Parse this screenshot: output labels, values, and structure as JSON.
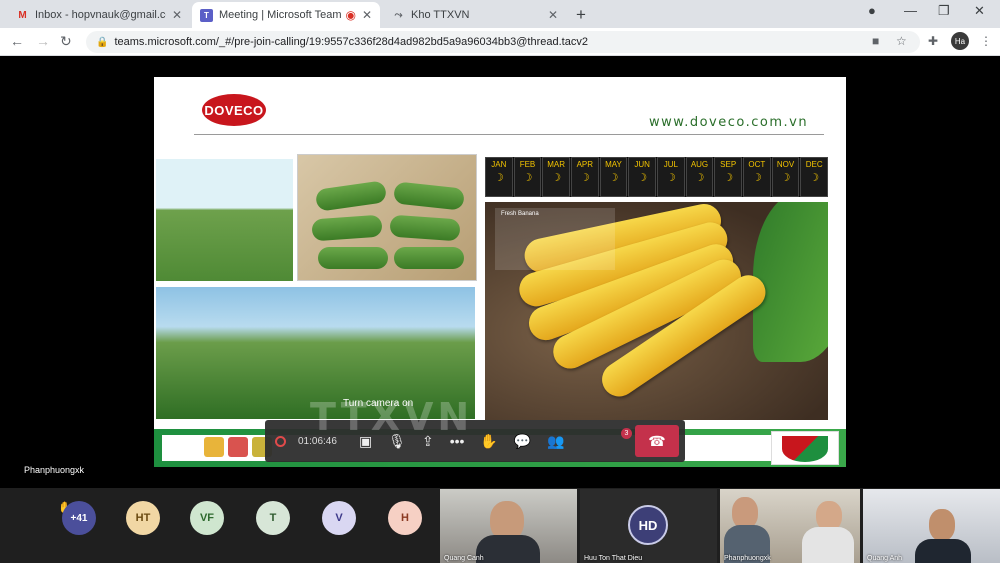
{
  "browser": {
    "tabs": [
      {
        "title": "Inbox - hopvnauk@gmail.com",
        "icon": "gmail-icon"
      },
      {
        "title": "Meeting | Microsoft Teams",
        "icon": "teams-icon"
      },
      {
        "title": "",
        "icon": "record-icon"
      },
      {
        "title": "Kho TTXVN",
        "icon": "link-icon"
      }
    ],
    "url": "teams.microsoft.com/_#/pre-join-calling/19:9557c336f28d4ad982bd5a9a96034bb3@thread.tacv2",
    "profile_initials": "Ha"
  },
  "slide": {
    "logo_text": "DOVECO",
    "website": "www.doveco.com.vn",
    "months": [
      "JAN",
      "FEB",
      "MAR",
      "APR",
      "MAY",
      "JUN",
      "JUL",
      "AUG",
      "SEP",
      "OCT",
      "NOV",
      "DEC"
    ],
    "spec_title": "Fresh Banana"
  },
  "meeting": {
    "presenter_name": "Phanphuongxk",
    "turn_camera_label": "Turn camera on",
    "timer": "01:06:46",
    "chat_badge": "3",
    "watermark": "TTXVN"
  },
  "participants": {
    "more_count": "+41",
    "avatars": [
      {
        "initials": "HT",
        "bg": "#f1d7a4",
        "fg": "#6a4a10"
      },
      {
        "initials": "VF",
        "bg": "#cfe6cf",
        "fg": "#2e6a2e"
      },
      {
        "initials": "T",
        "bg": "#d7e6d7",
        "fg": "#2e5a2e"
      },
      {
        "initials": "V",
        "bg": "#d9d7f2",
        "fg": "#3d3a8a"
      },
      {
        "initials": "H",
        "bg": "#f6d0c4",
        "fg": "#8a3a22"
      }
    ],
    "tiles": [
      {
        "name": "Quang Canh"
      },
      {
        "name": "Huu Ton That Dieu",
        "initials": "HD"
      },
      {
        "name": "Phanphuongxk"
      },
      {
        "name": "Quang Anh"
      }
    ]
  }
}
